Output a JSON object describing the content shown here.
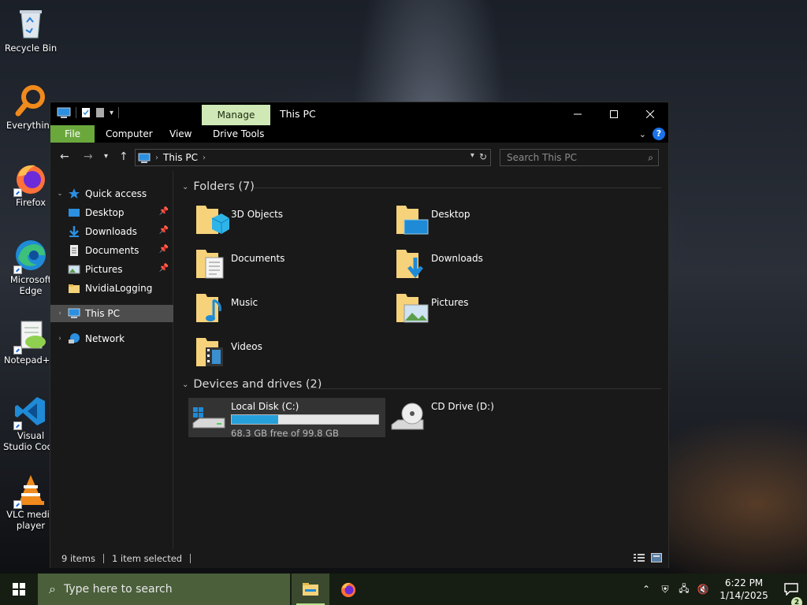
{
  "desktop": {
    "icons": [
      {
        "label": "Recycle Bin",
        "icon": "recycle-bin-icon"
      },
      {
        "label": "Everything",
        "icon": "everything-search-icon"
      },
      {
        "label": "Firefox",
        "icon": "firefox-icon"
      },
      {
        "label": "Microsoft Edge",
        "icon": "edge-icon"
      },
      {
        "label": "Notepad++",
        "icon": "notepadpp-icon"
      },
      {
        "label": "Visual Studio Code",
        "icon": "vscode-icon"
      },
      {
        "label": "VLC media player",
        "icon": "vlc-icon"
      }
    ]
  },
  "window": {
    "title": "This PC",
    "contextual_tab": "Manage",
    "ribbon_tabs": [
      "File",
      "Computer",
      "View",
      "Drive Tools"
    ],
    "address": {
      "segments": [
        "This PC"
      ]
    },
    "search": {
      "placeholder": "Search This PC"
    },
    "nav_pane": {
      "quick_access": "Quick access",
      "quick_items": [
        {
          "label": "Desktop",
          "pinned": true
        },
        {
          "label": "Downloads",
          "pinned": true
        },
        {
          "label": "Documents",
          "pinned": true
        },
        {
          "label": "Pictures",
          "pinned": true
        },
        {
          "label": "NvidiaLogging",
          "pinned": false
        }
      ],
      "this_pc": "This PC",
      "network": "Network"
    },
    "folders_header": "Folders (7)",
    "folders": [
      {
        "label": "3D Objects",
        "icon": "folder-3d-objects-icon"
      },
      {
        "label": "Desktop",
        "icon": "folder-desktop-icon"
      },
      {
        "label": "Documents",
        "icon": "folder-documents-icon"
      },
      {
        "label": "Downloads",
        "icon": "folder-downloads-icon"
      },
      {
        "label": "Music",
        "icon": "folder-music-icon"
      },
      {
        "label": "Pictures",
        "icon": "folder-pictures-icon"
      },
      {
        "label": "Videos",
        "icon": "folder-videos-icon"
      }
    ],
    "drives_header": "Devices and drives (2)",
    "drives": [
      {
        "label": "Local Disk (C:)",
        "free_text": "68.3 GB free of 99.8 GB",
        "used_fraction": 0.316,
        "selected": true
      },
      {
        "label": "CD Drive (D:)",
        "selected": false
      }
    ],
    "status": {
      "items": "9 items",
      "selected": "1 item selected"
    }
  },
  "taskbar": {
    "search_placeholder": "Type here to search",
    "time": "6:22 PM",
    "date": "1/14/2025",
    "notification_count": "2"
  },
  "colors": {
    "accent_green": "#cfe8b5",
    "file_tab": "#6aa83c",
    "progress": "#26a0da",
    "taskbar_search": "#4a5f3a"
  }
}
